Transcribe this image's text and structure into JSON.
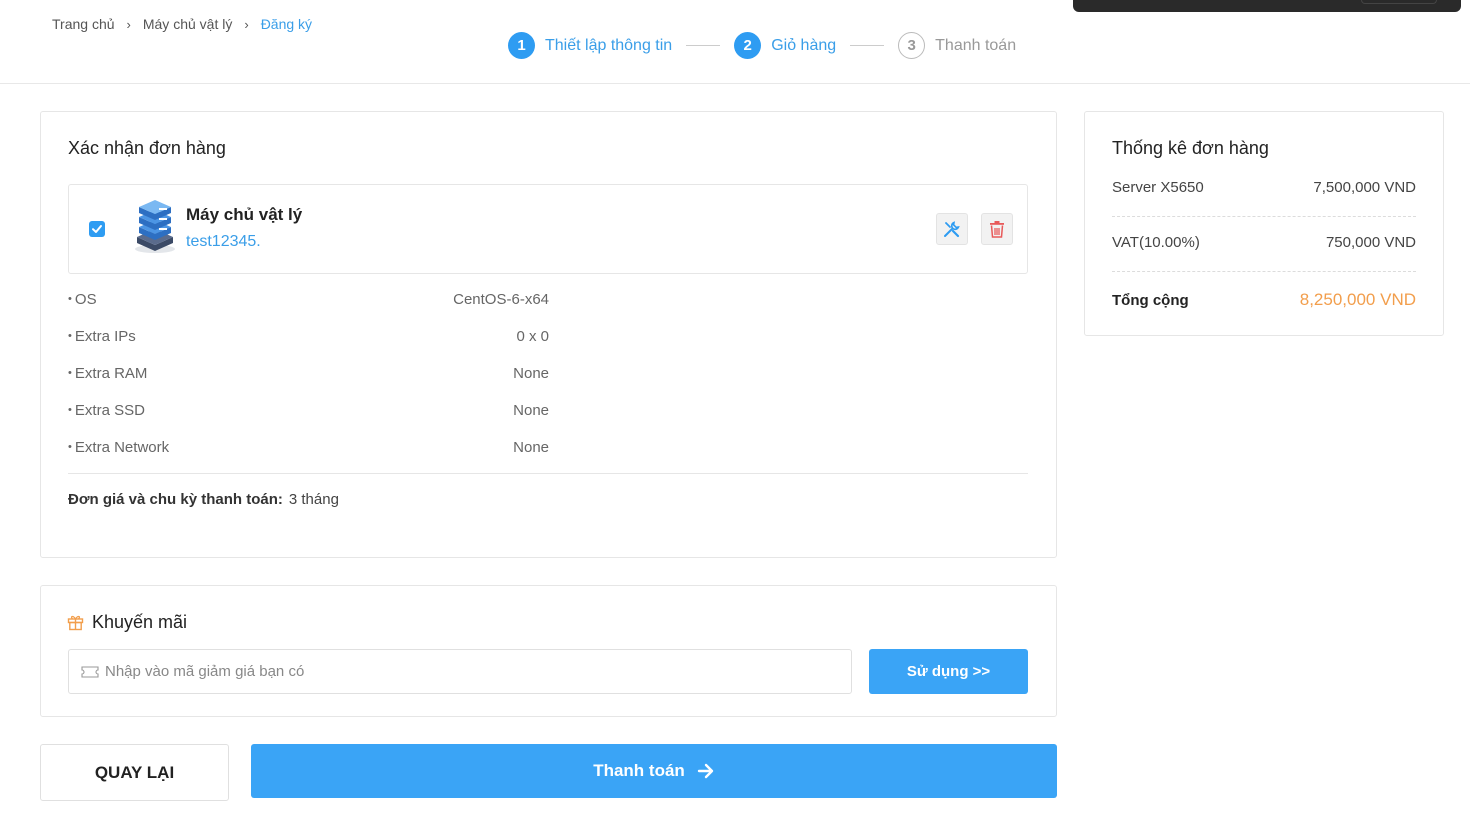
{
  "breadcrumb": {
    "home": "Trang chủ",
    "category": "Máy chủ vật lý",
    "current": "Đăng ký"
  },
  "steps": [
    {
      "num": "1",
      "label": "Thiết lập thông tin"
    },
    {
      "num": "2",
      "label": "Giỏ hàng"
    },
    {
      "num": "3",
      "label": "Thanh toán"
    }
  ],
  "order": {
    "title": "Xác nhận đơn hàng",
    "product_name": "Máy chủ vật lý",
    "product_host": "test12345.",
    "specs": [
      {
        "key": "OS",
        "value": "CentOS-6-x64"
      },
      {
        "key": "Extra IPs",
        "value": "0 x 0"
      },
      {
        "key": "Extra RAM",
        "value": "None"
      },
      {
        "key": "Extra SSD",
        "value": "None"
      },
      {
        "key": "Extra Network",
        "value": "None"
      }
    ],
    "cycle_label": "Đơn giá và chu kỳ thanh toán:",
    "cycle_value": "3 tháng"
  },
  "promo": {
    "title": "Khuyến mãi",
    "placeholder": "Nhập vào mã giảm giá bạn có",
    "apply_label": "Sử dụng >>"
  },
  "actions": {
    "back_label": "QUAY LẠI",
    "pay_label": "Thanh toán"
  },
  "summary": {
    "title": "Thống kê đơn hàng",
    "rows": [
      {
        "label": "Server X5650",
        "value": "7,500,000 VND"
      },
      {
        "label": "VAT(10.00%)",
        "value": "750,000 VND"
      }
    ],
    "total_label": "Tổng cộng",
    "total_value": "8,250,000 VND"
  },
  "colors": {
    "accent": "#2e9cf2",
    "total": "#f29e4c",
    "delete": "#e85a5a"
  }
}
